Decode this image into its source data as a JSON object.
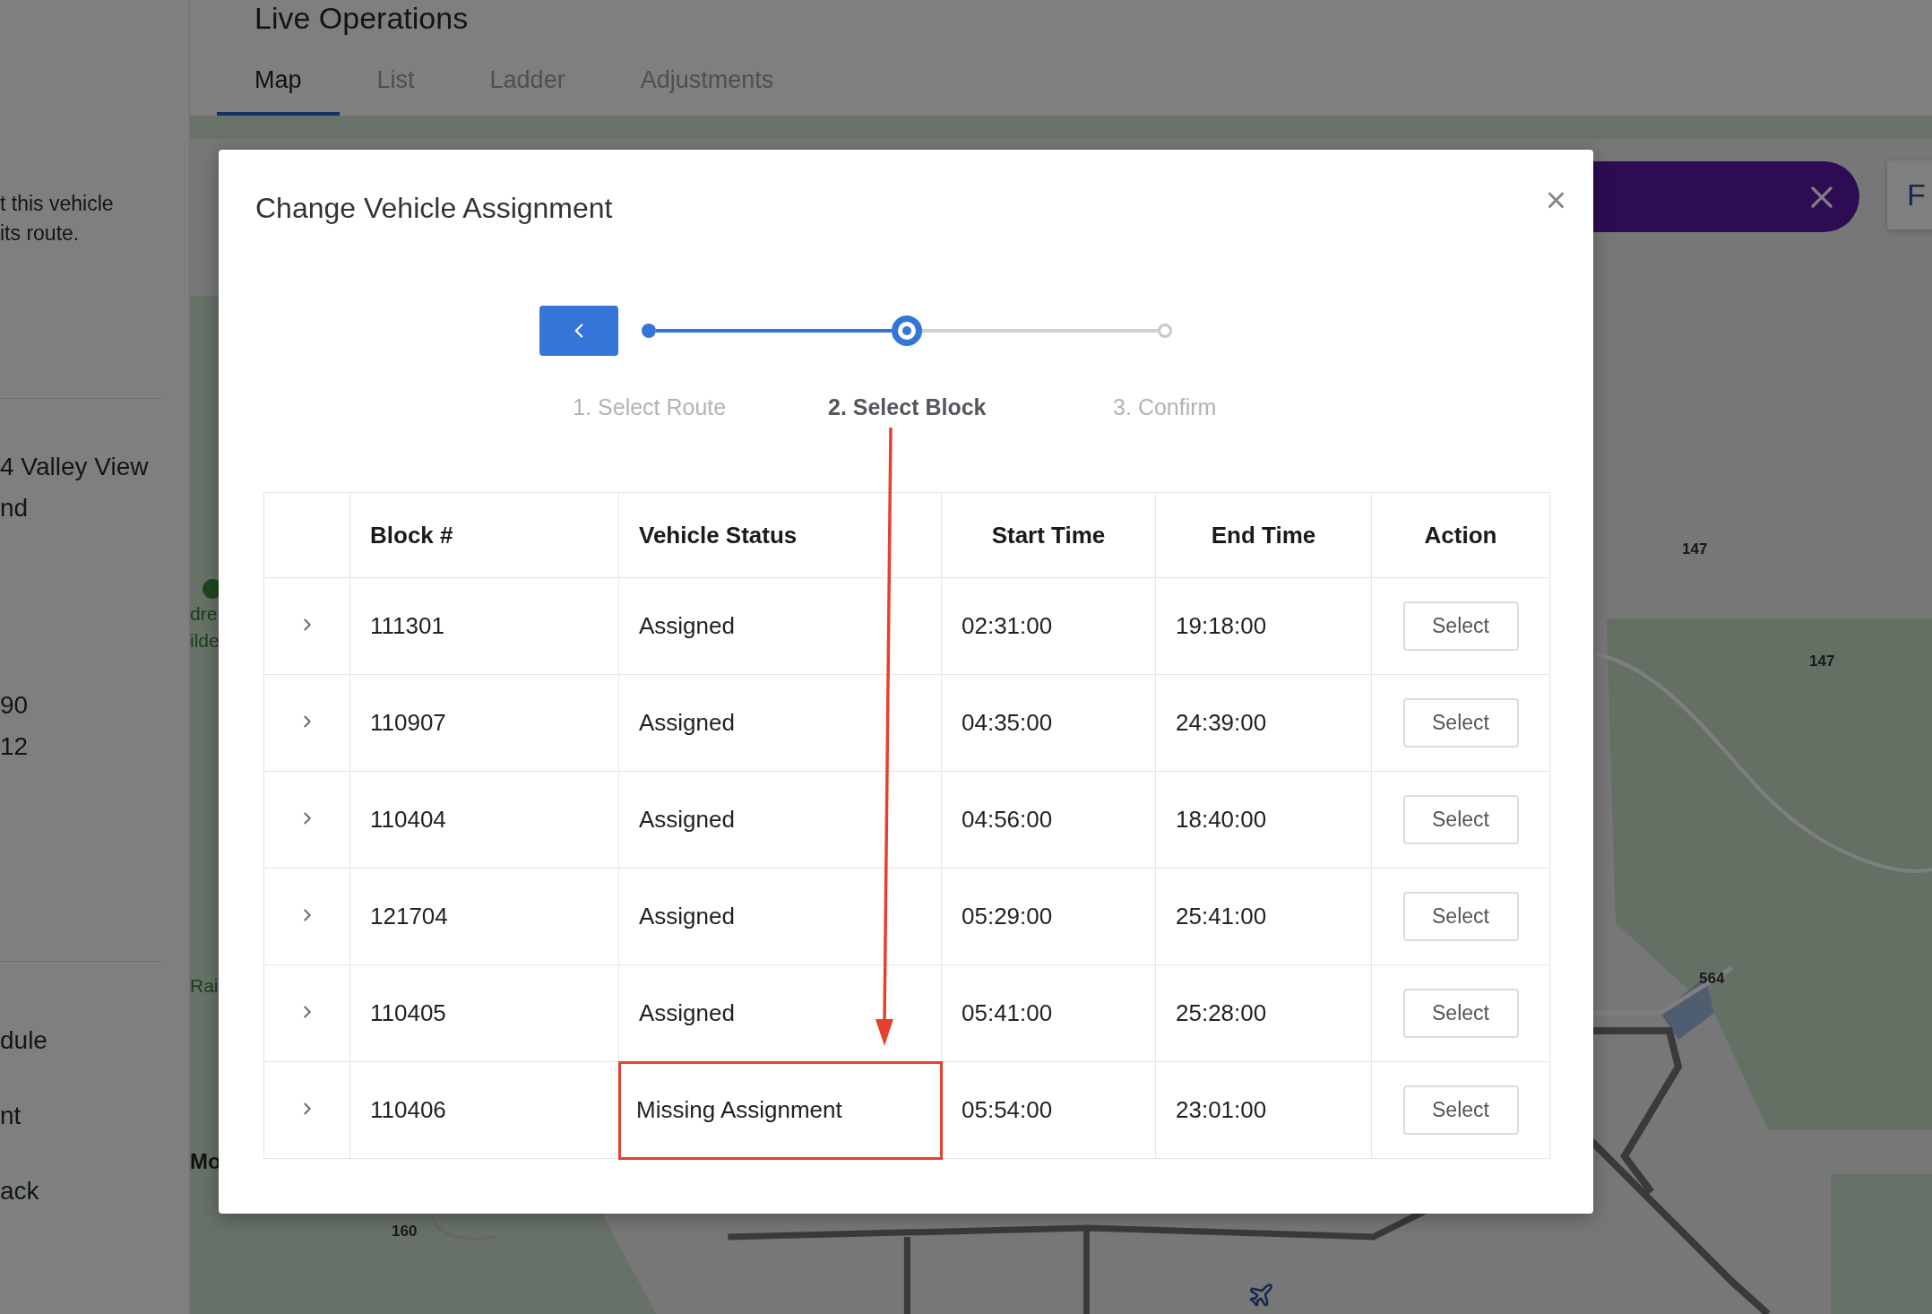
{
  "page": {
    "title": "Live Operations"
  },
  "tabs": [
    {
      "label": "Map",
      "selected": true
    },
    {
      "label": "List",
      "selected": false
    },
    {
      "label": "Ladder",
      "selected": false
    },
    {
      "label": "Adjustments",
      "selected": false
    }
  ],
  "sidebar": {
    "sections": [
      {
        "lines": [
          "t this vehicle",
          "its route."
        ],
        "kind": "note"
      },
      {
        "lines": [
          "4 Valley View",
          "nd",
          "90",
          "12"
        ],
        "kind": "detail"
      },
      {
        "lines": [
          "dule",
          "nt",
          "ack"
        ],
        "kind": "menu"
      }
    ]
  },
  "map": {
    "labels": [
      {
        "text": "dre",
        "kind": "place"
      },
      {
        "text": "ilde",
        "kind": "place"
      },
      {
        "text": "Rai",
        "kind": "place"
      },
      {
        "text": "Mo",
        "kind": "city"
      },
      {
        "text": "160",
        "kind": "road"
      },
      {
        "text": "147",
        "kind": "road"
      },
      {
        "text": "147",
        "kind": "road"
      },
      {
        "text": "564",
        "kind": "road"
      }
    ],
    "side_button": "F"
  },
  "dialog": {
    "title": "Change Vehicle Assignment",
    "close": "×",
    "steps": [
      {
        "label": "1. Select Route",
        "completed": true,
        "selected": false
      },
      {
        "label": "2. Select Block",
        "completed": false,
        "selected": true
      },
      {
        "label": "3. Confirm",
        "completed": false,
        "selected": false
      }
    ],
    "table": {
      "columns": [
        "Block #",
        "Vehicle Status",
        "Start Time",
        "End Time",
        "Action"
      ],
      "rows": [
        {
          "block": "111301",
          "status": "Assigned",
          "start": "02:31:00",
          "end": "19:18:00",
          "action": "Select",
          "highlighted": false
        },
        {
          "block": "110907",
          "status": "Assigned",
          "start": "04:35:00",
          "end": "24:39:00",
          "action": "Select",
          "highlighted": false
        },
        {
          "block": "110404",
          "status": "Assigned",
          "start": "04:56:00",
          "end": "18:40:00",
          "action": "Select",
          "highlighted": false
        },
        {
          "block": "121704",
          "status": "Assigned",
          "start": "05:29:00",
          "end": "25:41:00",
          "action": "Select",
          "highlighted": false
        },
        {
          "block": "110405",
          "status": "Assigned",
          "start": "05:41:00",
          "end": "25:28:00",
          "action": "Select",
          "highlighted": false
        },
        {
          "block": "110406",
          "status": "Missing Assignment",
          "start": "05:54:00",
          "end": "23:01:00",
          "action": "Select",
          "highlighted": true
        }
      ]
    }
  }
}
